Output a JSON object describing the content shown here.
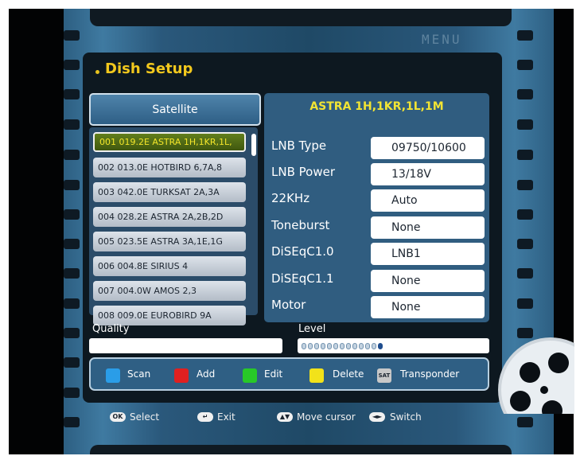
{
  "menu_label": "MENU",
  "title": "Dish Setup",
  "satellite_header": "Satellite",
  "satellites": [
    "001 019.2E ASTRA 1H,1KR,1L,",
    "002 013.0E HOTBIRD 6,7A,8",
    "003 042.0E TURKSAT 2A,3A",
    "004 028.2E ASTRA 2A,2B,2D",
    "005 023.5E ASTRA 3A,1E,1G",
    "006 004.8E SIRIUS 4",
    "007 004.0W AMOS 2,3",
    "008 009.0E EUROBIRD 9A"
  ],
  "selected_index": 0,
  "right_panel": {
    "title": "ASTRA 1H,1KR,1L,1M",
    "params": [
      {
        "label": "LNB Type",
        "value": "09750/10600"
      },
      {
        "label": "LNB Power",
        "value": "13/18V"
      },
      {
        "label": "22KHz",
        "value": "Auto"
      },
      {
        "label": "Toneburst",
        "value": "None"
      },
      {
        "label": "DiSEqC1.0",
        "value": "LNB1"
      },
      {
        "label": "DiSEqC1.1",
        "value": "None"
      },
      {
        "label": "Motor",
        "value": "None"
      }
    ]
  },
  "signal": {
    "quality_label": "Quality",
    "quality_value": 0,
    "level_label": "Level",
    "level_segments_total": 13,
    "level_segments_active": 1
  },
  "legend": [
    {
      "label": "Scan",
      "color": "#2a9de8"
    },
    {
      "label": "Add",
      "color": "#e02020"
    },
    {
      "label": "Edit",
      "color": "#28c828"
    },
    {
      "label": "Delete",
      "color": "#f2e21a"
    },
    {
      "label": "Transponder",
      "icon": "SAT",
      "color": "#c8c8c8"
    }
  ],
  "hints": [
    {
      "icon": "OK",
      "label": "Select"
    },
    {
      "icon": "↵",
      "label": "Exit"
    },
    {
      "icon": "▲▼",
      "label": "Move cursor"
    },
    {
      "icon": "◄►",
      "label": "Switch"
    }
  ]
}
